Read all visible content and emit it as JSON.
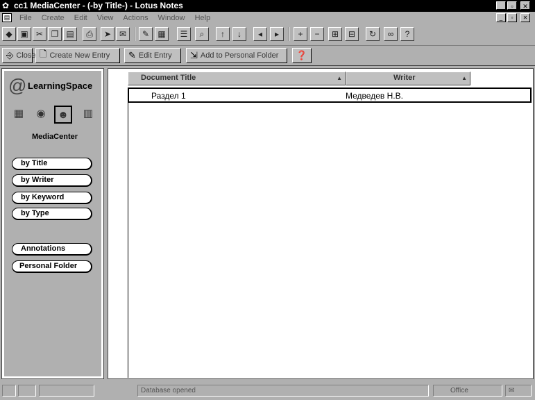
{
  "window": {
    "title": "cc1 MediaCenter - (-by Title-) - Lotus Notes",
    "app_icon": "lotus-icon",
    "controls": [
      "minimize",
      "maximize",
      "close"
    ]
  },
  "menubar": {
    "items": [
      "File",
      "Create",
      "Edit",
      "View",
      "Actions",
      "Window",
      "Help"
    ]
  },
  "toolbar": {
    "icons": [
      "open-database-icon",
      "save-icon",
      "cut-icon",
      "copy-icon",
      "paste-icon",
      "print-icon",
      "send-icon",
      "mail-icon",
      "pencil-icon",
      "edit-document-icon",
      "properties-icon",
      "search-icon",
      "previous-icon",
      "next-icon",
      "back-icon",
      "forward-icon",
      "expand-icon",
      "collapse-icon",
      "expand-all-icon",
      "collapse-all-icon",
      "refresh-icon",
      "binoculars-icon",
      "help-icon"
    ]
  },
  "actionbar": {
    "buttons": [
      {
        "label": "Close",
        "icon": "close-door-icon"
      },
      {
        "label": "Create New Entry",
        "icon": "new-document-icon"
      },
      {
        "label": "Edit Entry",
        "icon": "edit-icon"
      },
      {
        "label": "Add to Personal Folder",
        "icon": "folder-add-icon"
      },
      {
        "label": "",
        "icon": "help-icon"
      }
    ]
  },
  "navigator": {
    "logo_text": "LearningSpace",
    "icons": [
      "schedule-icon",
      "cd-icon",
      "people-icon",
      "book-icon"
    ],
    "section_label": "MediaCenter",
    "views": [
      "by Title",
      "by Writer",
      "by Keyword",
      "by Type"
    ],
    "extras": [
      "Annotations",
      "Personal Folder"
    ]
  },
  "view": {
    "columns": [
      {
        "label": "Document Title",
        "sort": "▲"
      },
      {
        "label": "Writer",
        "sort": "▲"
      }
    ],
    "rows": [
      {
        "title": "Раздел 1",
        "writer": "Медведев Н.В."
      }
    ]
  },
  "statusbar": {
    "message": "Database opened",
    "location": "Office"
  }
}
